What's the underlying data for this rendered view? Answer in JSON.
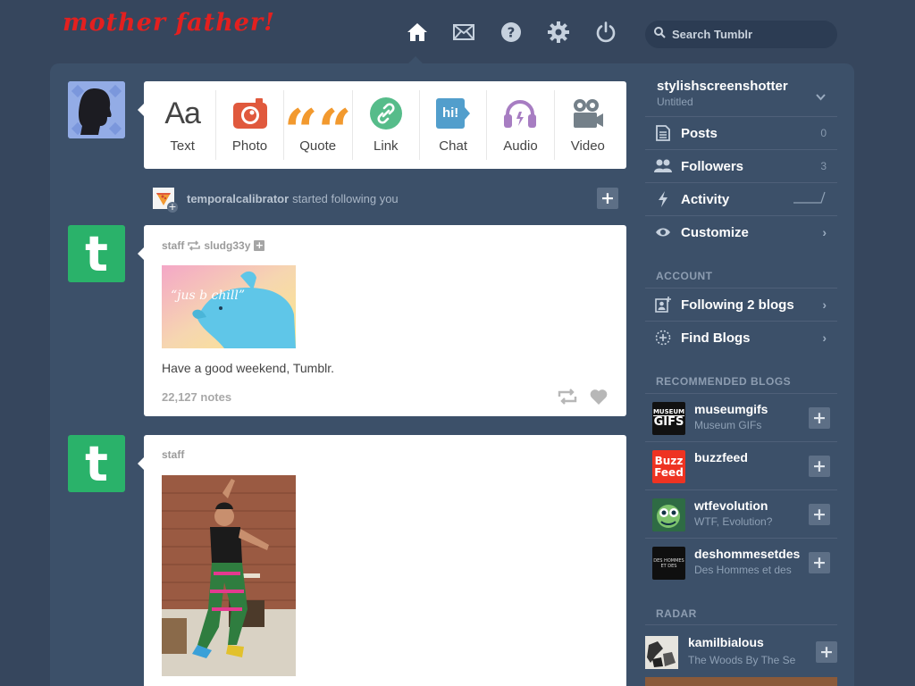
{
  "header": {
    "logo_text": "mother father!",
    "nav_icons": [
      "home-icon",
      "mail-icon",
      "help-icon",
      "gear-icon",
      "power-icon"
    ],
    "search_placeholder": "Search Tumblr"
  },
  "post_types": [
    {
      "label": "Text",
      "icon": "text-icon",
      "glyph": "Aa",
      "color": "#444444"
    },
    {
      "label": "Photo",
      "icon": "camera-icon",
      "color": "#e0593d"
    },
    {
      "label": "Quote",
      "icon": "quote-icon",
      "glyph": "““",
      "color": "#f2992e"
    },
    {
      "label": "Link",
      "icon": "link-icon",
      "color": "#56bc8a"
    },
    {
      "label": "Chat",
      "icon": "chat-icon",
      "glyph": "hi!",
      "color": "#529ecc"
    },
    {
      "label": "Audio",
      "icon": "headphones-icon",
      "color": "#a77dc2"
    },
    {
      "label": "Video",
      "icon": "video-camera-icon",
      "color": "#748089"
    }
  ],
  "activity": {
    "user": "temporalcalibrator",
    "text": "started following you"
  },
  "posts": [
    {
      "author": "staff",
      "reblogged_from": "sludg33y",
      "image_text": "“jus b chill”",
      "body": "Have a good weekend, Tumblr.",
      "notes": "22,127 notes"
    },
    {
      "author": "staff"
    }
  ],
  "sidebar": {
    "blog_name": "stylishscreenshotter",
    "blog_title": "Untitled",
    "items": [
      {
        "label": "Posts",
        "value": "0",
        "icon": "posts-icon"
      },
      {
        "label": "Followers",
        "value": "3",
        "icon": "followers-icon"
      },
      {
        "label": "Activity",
        "icon": "bolt-icon"
      },
      {
        "label": "Customize",
        "icon": "eye-icon"
      }
    ],
    "account_heading": "ACCOUNT",
    "account_items": [
      {
        "label": "Following 2 blogs",
        "icon": "following-icon"
      },
      {
        "label": "Find Blogs",
        "icon": "find-blogs-icon"
      }
    ],
    "recommended_heading": "RECOMMENDED BLOGS",
    "recommended": [
      {
        "name": "museumgifs",
        "subtitle": "Museum GIFs",
        "avatar_text": "MUSEUM GIFS"
      },
      {
        "name": "buzzfeed",
        "subtitle": "",
        "avatar_text": "Buzz Feed"
      },
      {
        "name": "wtfevolution",
        "subtitle": "WTF, Evolution?"
      },
      {
        "name": "deshommesetdes",
        "subtitle": "Des Hommes et des",
        "avatar_text": "DES HOMMES ET DES"
      }
    ],
    "radar_heading": "RADAR",
    "radar": {
      "name": "kamilbialous",
      "subtitle": "The Woods By The Se"
    }
  }
}
